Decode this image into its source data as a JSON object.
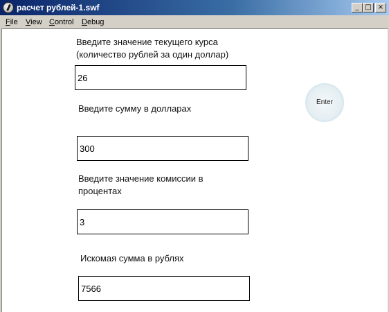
{
  "window": {
    "title": "расчет рублей-1.swf",
    "icon": "flash-player-icon",
    "minimize_glyph": "_",
    "maximize_glyph": "□",
    "close_glyph": "×"
  },
  "menu": {
    "items": [
      {
        "accel": "F",
        "rest": "ile"
      },
      {
        "accel": "V",
        "rest": "iew"
      },
      {
        "accel": "C",
        "rest": "ontrol"
      },
      {
        "accel": "D",
        "rest": "ebug"
      }
    ]
  },
  "form": {
    "rate_label_line1": "Введите значение текущего курса",
    "rate_label_line2": "(количество рублей за один доллар)",
    "rate_value": "26",
    "dollars_label": "Введите сумму в долларах",
    "dollars_value": "300",
    "commission_label_line1": "Введите значение комиссии в",
    "commission_label_line2": "процентах",
    "commission_value": "3",
    "result_label": "Искомая сумма в рублях",
    "result_value": "7566",
    "enter_label": "Enter"
  }
}
